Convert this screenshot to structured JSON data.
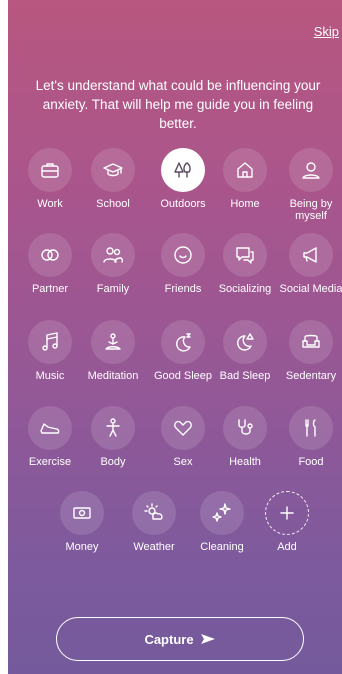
{
  "header": {
    "skip_label": "Skip"
  },
  "intro_text": "Let's understand what could be influencing your anxiety. That will help me guide you in feeling better.",
  "categories": [
    {
      "label": "Work",
      "icon": "briefcase-icon",
      "selected": false
    },
    {
      "label": "School",
      "icon": "graduation-cap-icon",
      "selected": false
    },
    {
      "label": "Outdoors",
      "icon": "trees-icon",
      "selected": true
    },
    {
      "label": "Home",
      "icon": "house-icon",
      "selected": false
    },
    {
      "label": "Being by myself",
      "icon": "person-icon",
      "selected": false
    },
    {
      "label": "Partner",
      "icon": "rings-icon",
      "selected": false
    },
    {
      "label": "Family",
      "icon": "people-icon",
      "selected": false
    },
    {
      "label": "Friends",
      "icon": "chat-bubble-icon",
      "selected": false
    },
    {
      "label": "Socializing",
      "icon": "speech-bubbles-icon",
      "selected": false
    },
    {
      "label": "Social Media",
      "icon": "megaphone-icon",
      "selected": false
    },
    {
      "label": "Music",
      "icon": "music-note-icon",
      "selected": false
    },
    {
      "label": "Meditation",
      "icon": "meditation-icon",
      "selected": false
    },
    {
      "label": "Good Sleep",
      "icon": "moon-zzz-icon",
      "selected": false
    },
    {
      "label": "Bad Sleep",
      "icon": "moon-warning-icon",
      "selected": false
    },
    {
      "label": "Sedentary",
      "icon": "armchair-icon",
      "selected": false
    },
    {
      "label": "Exercise",
      "icon": "sneaker-icon",
      "selected": false
    },
    {
      "label": "Body",
      "icon": "body-icon",
      "selected": false
    },
    {
      "label": "Sex",
      "icon": "heart-icon",
      "selected": false
    },
    {
      "label": "Health",
      "icon": "stethoscope-icon",
      "selected": false
    },
    {
      "label": "Food",
      "icon": "utensils-icon",
      "selected": false
    },
    {
      "label": "Money",
      "icon": "money-icon",
      "selected": false
    },
    {
      "label": "Weather",
      "icon": "sun-cloud-icon",
      "selected": false
    },
    {
      "label": "Cleaning",
      "icon": "sparkles-icon",
      "selected": false
    },
    {
      "label": "Add",
      "icon": "plus-icon",
      "selected": false
    }
  ],
  "capture_button": {
    "label": "Capture"
  },
  "colors": {
    "gradient_top": "#b8577f",
    "gradient_bottom": "#745a9c",
    "selected_bg": "#ffffff",
    "selected_icon": "#5a4a60"
  }
}
